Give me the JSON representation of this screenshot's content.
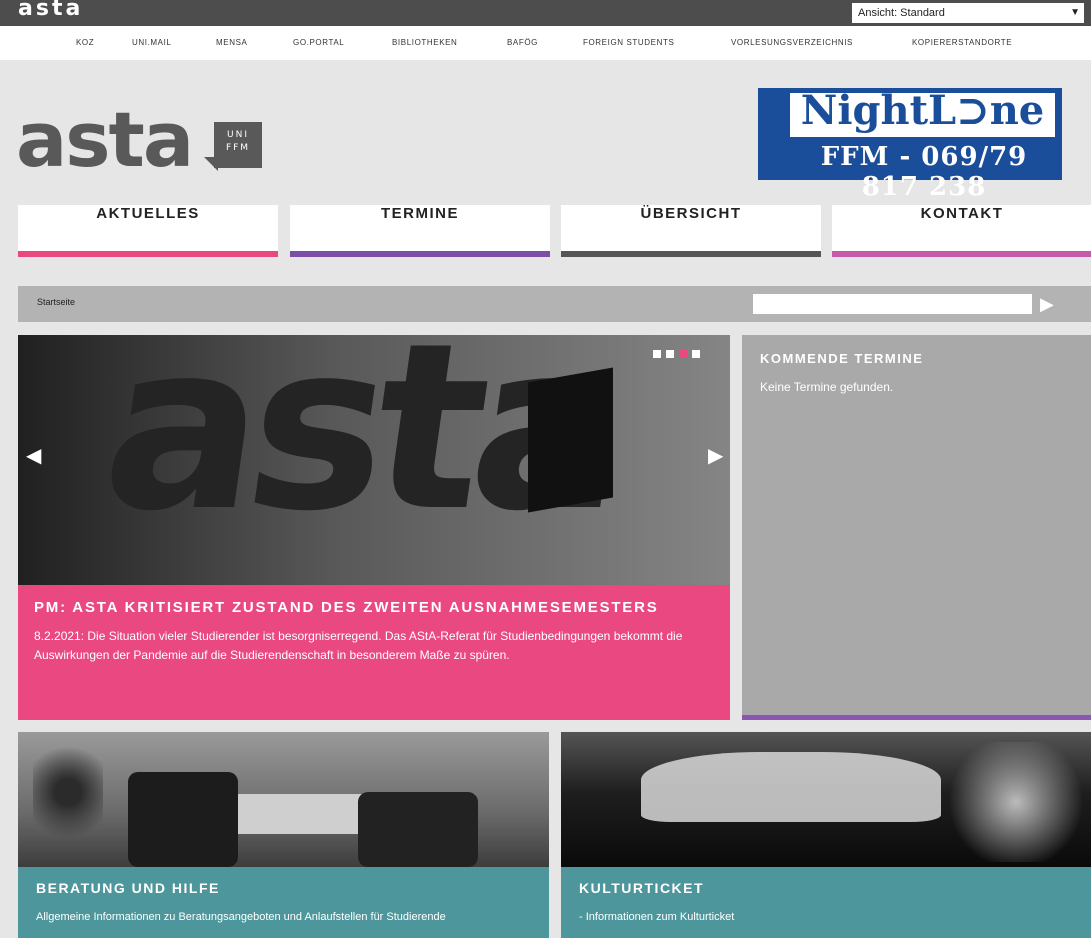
{
  "topbar": {
    "logo_text": "asta",
    "view_select": "Ansicht: Standard"
  },
  "util_links": [
    "KOZ",
    "UNI.MAIL",
    "MENSA",
    "GO.PORTAL",
    "BIBLIOTHEKEN",
    "BAFÖG",
    "FOREIGN STUDENTS",
    "VORLESUNGSVERZEICHNIS",
    "KOPIERERSTANDORTE"
  ],
  "logo": {
    "letters": "asta",
    "badge_line1": "UNI",
    "badge_line2": "FFM"
  },
  "nightline": {
    "title": "NightL⊃ne",
    "phone": "FFM - 069/79 817 238"
  },
  "nav": [
    {
      "label": "AKTUELLES",
      "color": "#e94880"
    },
    {
      "label": "TERMINE",
      "color": "#7b4ea8"
    },
    {
      "label": "ÜBERSICHT",
      "color": "#555555"
    },
    {
      "label": "KONTAKT",
      "color": "#c55ba8"
    }
  ],
  "breadcrumb": {
    "label": "Startseite",
    "search_placeholder": ""
  },
  "slider": {
    "image_text": "asta",
    "headline": "PM: AStA kritisiert Zustand des zweiten Ausnahmesemesters",
    "text": "8.2.2021: Die Situation vieler Studierender ist besorgniserregend. Das AStA-Referat für Studienbedingungen bekommt die Auswirkungen der Pandemie auf die Studierendenschaft in besonderem Maße zu spüren.",
    "active_dot": 3,
    "dot_count": 4,
    "accent": "#e94880"
  },
  "events": {
    "heading": "Kommende Termine",
    "empty_text": "Keine Termine gefunden."
  },
  "tiles": [
    {
      "heading": "Beratung und Hilfe",
      "text": "Allgemeine Informationen zu Beratungsangeboten und Anlaufstellen für Studierende"
    },
    {
      "heading": "Kulturticket",
      "text": "- Informationen zum Kulturticket"
    }
  ]
}
